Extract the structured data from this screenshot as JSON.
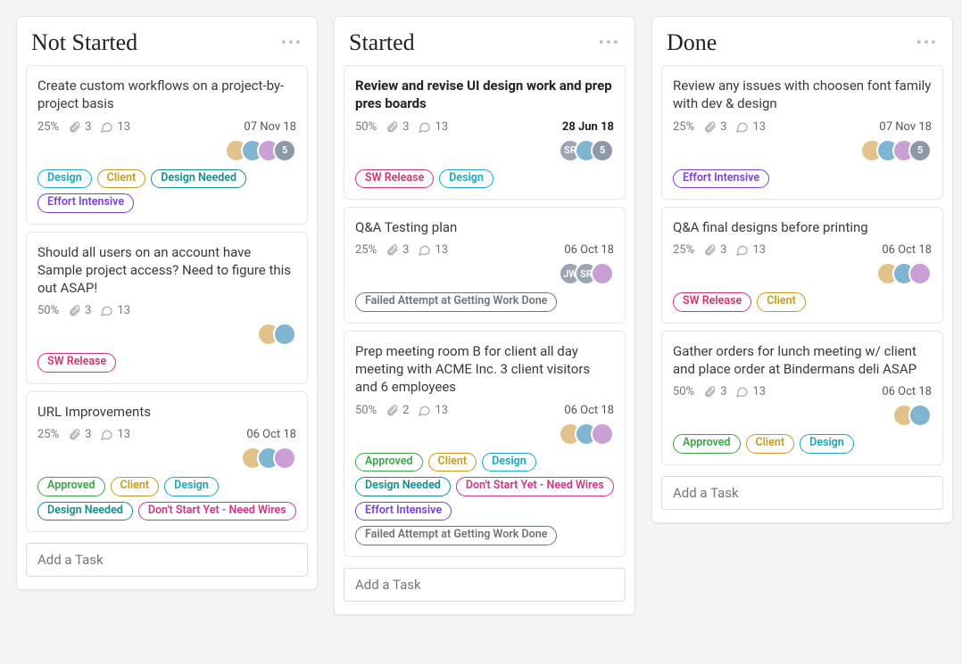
{
  "addTaskPlaceholder": "Add a Task",
  "tagStyles": {
    "Design": {
      "color": "#1aa6c4",
      "border": "#1aa6c4"
    },
    "Client": {
      "color": "#c79a1f",
      "border": "#c79a1f"
    },
    "Design Needed": {
      "color": "#0d8f8f",
      "border": "#0d8f8f"
    },
    "Effort Intensive": {
      "color": "#7a3fe0",
      "border": "#7a3fe0"
    },
    "SW Release": {
      "color": "#d6336c",
      "border": "#d6336c"
    },
    "Approved": {
      "color": "#3ba648",
      "border": "#3ba648"
    },
    "Don't Start Yet - Need Wires": {
      "color": "#d63384",
      "border": "#d63384"
    },
    "Failed Attempt at Getting Work Done": {
      "color": "#6c757d",
      "border": "#6c757d"
    }
  },
  "avatarPalette": [
    "#e2c28b",
    "#7fb5d1",
    "#c8a0d6",
    "#a3d39c",
    "#f0a17a",
    "#9aa5b1"
  ],
  "columns": [
    {
      "title": "Not Started",
      "cards": [
        {
          "title": "Create custom workflows on a project-by-project basis",
          "bold": false,
          "percent": "25%",
          "attachments": "3",
          "comments": "13",
          "date": "07 Nov 18",
          "dateBold": false,
          "avatars": [
            {
              "type": "img"
            },
            {
              "type": "img"
            },
            {
              "type": "img"
            },
            {
              "type": "count",
              "label": "5"
            }
          ],
          "tags": [
            "Design",
            "Client",
            "Design Needed",
            "Effort Intensive"
          ]
        },
        {
          "title": "Should all users on an account have Sample project access? Need to figure this out ASAP!",
          "bold": false,
          "percent": "50%",
          "attachments": "3",
          "comments": "13",
          "date": "",
          "dateBold": false,
          "avatars": [
            {
              "type": "img"
            },
            {
              "type": "img"
            }
          ],
          "tags": [
            "SW Release"
          ]
        },
        {
          "title": "URL Improvements",
          "bold": false,
          "percent": "25%",
          "attachments": "3",
          "comments": "13",
          "date": "06 Oct 18",
          "dateBold": false,
          "avatars": [
            {
              "type": "img"
            },
            {
              "type": "img"
            },
            {
              "type": "img"
            }
          ],
          "tags": [
            "Approved",
            "Client",
            "Design",
            "Design Needed",
            "Don't Start Yet - Need Wires"
          ]
        }
      ]
    },
    {
      "title": "Started",
      "cards": [
        {
          "title": "Review and revise UI design work and prep pres boards",
          "bold": true,
          "percent": "50%",
          "attachments": "3",
          "comments": "13",
          "date": "28 Jun 18",
          "dateBold": true,
          "avatars": [
            {
              "type": "initials",
              "label": "SR",
              "bg": "#9aa5b1"
            },
            {
              "type": "img"
            },
            {
              "type": "count",
              "label": "5"
            }
          ],
          "tags": [
            "SW Release",
            "Design"
          ]
        },
        {
          "title": "Q&A Testing plan",
          "bold": false,
          "percent": "25%",
          "attachments": "3",
          "comments": "13",
          "date": "06 Oct 18",
          "dateBold": false,
          "avatars": [
            {
              "type": "initials",
              "label": "JW",
              "bg": "#9aa5b1"
            },
            {
              "type": "initials",
              "label": "SR",
              "bg": "#9aa5b1"
            },
            {
              "type": "img"
            }
          ],
          "tags": [
            "Failed Attempt at Getting Work Done"
          ]
        },
        {
          "title": "Prep meeting room B for client all day meeting with ACME Inc. 3 client visitors and 6 employees",
          "bold": false,
          "percent": "50%",
          "attachments": "2",
          "comments": "13",
          "date": "06 Oct 18",
          "dateBold": false,
          "avatars": [
            {
              "type": "img"
            },
            {
              "type": "img"
            },
            {
              "type": "img"
            }
          ],
          "tags": [
            "Approved",
            "Client",
            "Design",
            "Design Needed",
            "Don't Start Yet - Need Wires",
            "Effort Intensive",
            "Failed Attempt at Getting Work Done"
          ]
        }
      ]
    },
    {
      "title": "Done",
      "cards": [
        {
          "title": "Review any issues with choosen font family with dev & design",
          "bold": false,
          "percent": "25%",
          "attachments": "3",
          "comments": "13",
          "date": "07 Nov 18",
          "dateBold": false,
          "avatars": [
            {
              "type": "img"
            },
            {
              "type": "img"
            },
            {
              "type": "img"
            },
            {
              "type": "count",
              "label": "5"
            }
          ],
          "tags": [
            "Effort Intensive"
          ]
        },
        {
          "title": "Q&A final designs before printing",
          "bold": false,
          "percent": "25%",
          "attachments": "3",
          "comments": "13",
          "date": "06 Oct 18",
          "dateBold": false,
          "avatars": [
            {
              "type": "img"
            },
            {
              "type": "img"
            },
            {
              "type": "img"
            }
          ],
          "tags": [
            "SW Release",
            "Client"
          ]
        },
        {
          "title": "Gather orders for lunch meeting w/ client and place order at Bindermans deli ASAP",
          "bold": false,
          "percent": "50%",
          "attachments": "3",
          "comments": "13",
          "date": "06 Oct 18",
          "dateBold": false,
          "avatars": [
            {
              "type": "img"
            },
            {
              "type": "img"
            }
          ],
          "tags": [
            "Approved",
            "Client",
            "Design"
          ]
        }
      ]
    }
  ]
}
